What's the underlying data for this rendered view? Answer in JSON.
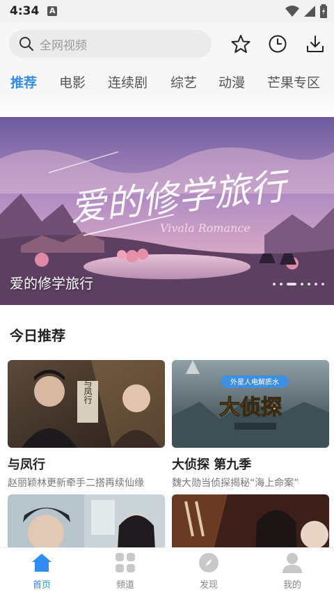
{
  "status_bar": {
    "time": "4:34",
    "notification_letter": "A"
  },
  "search": {
    "placeholder": "全网视频"
  },
  "header_icons": [
    "star-icon",
    "history-clock-icon",
    "download-icon"
  ],
  "tabs": [
    {
      "label": "推荐",
      "active": true
    },
    {
      "label": "电影",
      "active": false
    },
    {
      "label": "连续剧",
      "active": false
    },
    {
      "label": "综艺",
      "active": false
    },
    {
      "label": "动漫",
      "active": false
    },
    {
      "label": "芒果专区",
      "active": false
    }
  ],
  "banner": {
    "title": "爱的修学旅行",
    "art_title": "爱的修学旅行",
    "art_subtitle": "Vivala Romance",
    "dot_count": 7,
    "active_dot": 2
  },
  "section": {
    "title": "今日推荐"
  },
  "cards": [
    {
      "title": "与凤行",
      "desc": "赵丽颖林更新牵手二搭再续仙缘",
      "poster_text": "与凤行"
    },
    {
      "title": "大侦探 第九季",
      "desc": "魏大勋当侦探揭秘“海上命案”",
      "poster_text": "大侦探",
      "poster_badge": "外星人电解质水"
    },
    {
      "title": "",
      "desc": ""
    },
    {
      "title": "",
      "desc": ""
    }
  ],
  "bottom_nav": [
    {
      "label": "首页",
      "icon": "home-icon",
      "active": true
    },
    {
      "label": "频道",
      "icon": "grid-icon",
      "active": false
    },
    {
      "label": "发现",
      "icon": "compass-icon",
      "active": false
    },
    {
      "label": "我的",
      "icon": "user-icon",
      "active": false
    }
  ],
  "colors": {
    "accent": "#2f8df5",
    "inactive": "#888888"
  }
}
